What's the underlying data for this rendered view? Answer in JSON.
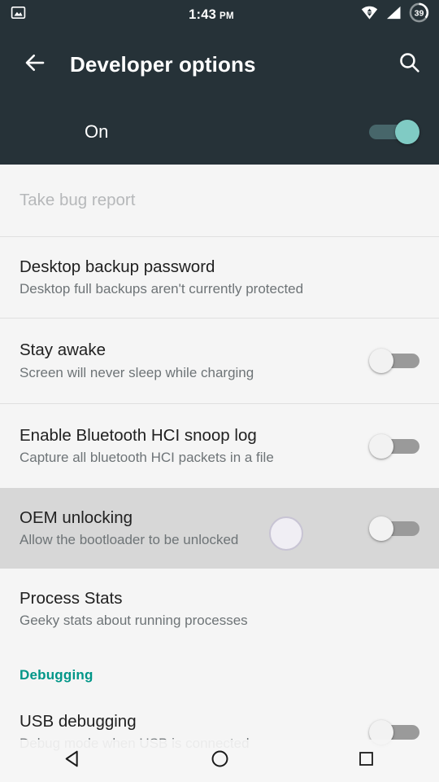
{
  "status_bar": {
    "notification_icon": "image-icon",
    "time": "1:43",
    "ampm": "PM",
    "wifi_icon": "wifi-icon",
    "signal_icon": "cell-signal-icon",
    "battery_level": "39"
  },
  "app_bar": {
    "back_icon": "back-arrow-icon",
    "title": "Developer options",
    "search_icon": "search-icon"
  },
  "master_switch": {
    "label": "On",
    "state": "on"
  },
  "colors": {
    "app_bar_bg": "#263238",
    "page_bg": "#f5f5f5",
    "accent_teal": "#009688",
    "switch_on_thumb": "#80cbc4",
    "switch_on_track": "#47666a",
    "switch_off_thumb": "#f2f2f2",
    "switch_off_track": "#9a9a9a",
    "pressed_row_bg": "#d7d7d7"
  },
  "list": [
    {
      "type": "item",
      "name": "take-bug-report",
      "title": "Take bug report",
      "subtitle": "",
      "disabled": true,
      "has_switch": false,
      "pressed": false,
      "height": 88
    },
    {
      "type": "divider"
    },
    {
      "type": "item",
      "name": "desktop-backup-password",
      "title": "Desktop backup password",
      "subtitle": "Desktop full backups aren't currently protected",
      "disabled": false,
      "has_switch": false,
      "pressed": false,
      "height": 99
    },
    {
      "type": "divider"
    },
    {
      "type": "item",
      "name": "stay-awake",
      "title": "Stay awake",
      "subtitle": "Screen will never sleep while charging",
      "disabled": false,
      "has_switch": true,
      "switch_state": "off",
      "pressed": false,
      "height": 104
    },
    {
      "type": "divider"
    },
    {
      "type": "item",
      "name": "enable-bluetooth-hci-snoop-log",
      "title": "Enable Bluetooth HCI snoop log",
      "subtitle": "Capture all bluetooth HCI packets in a file",
      "disabled": false,
      "has_switch": true,
      "switch_state": "off",
      "pressed": false,
      "height": 103
    },
    {
      "type": "item",
      "name": "oem-unlocking",
      "title": "OEM unlocking",
      "subtitle": "Allow the bootloader to be unlocked",
      "disabled": false,
      "has_switch": true,
      "switch_state": "off",
      "pressed": true,
      "height": 99
    },
    {
      "type": "item",
      "name": "process-stats",
      "title": "Process Stats",
      "subtitle": "Geeky stats about running processes",
      "disabled": false,
      "has_switch": false,
      "pressed": false,
      "height": 99
    },
    {
      "type": "section",
      "name": "debugging-section-header",
      "title": "Debugging"
    },
    {
      "type": "item",
      "name": "usb-debugging",
      "title": "USB debugging",
      "subtitle": "Debug mode when USB is connected",
      "disabled": false,
      "has_switch": true,
      "switch_state": "off",
      "pressed": false,
      "height": 99
    }
  ],
  "nav_bar": {
    "back_icon": "nav-back-triangle-icon",
    "home_icon": "nav-home-circle-icon",
    "recents_icon": "nav-recents-square-icon"
  }
}
